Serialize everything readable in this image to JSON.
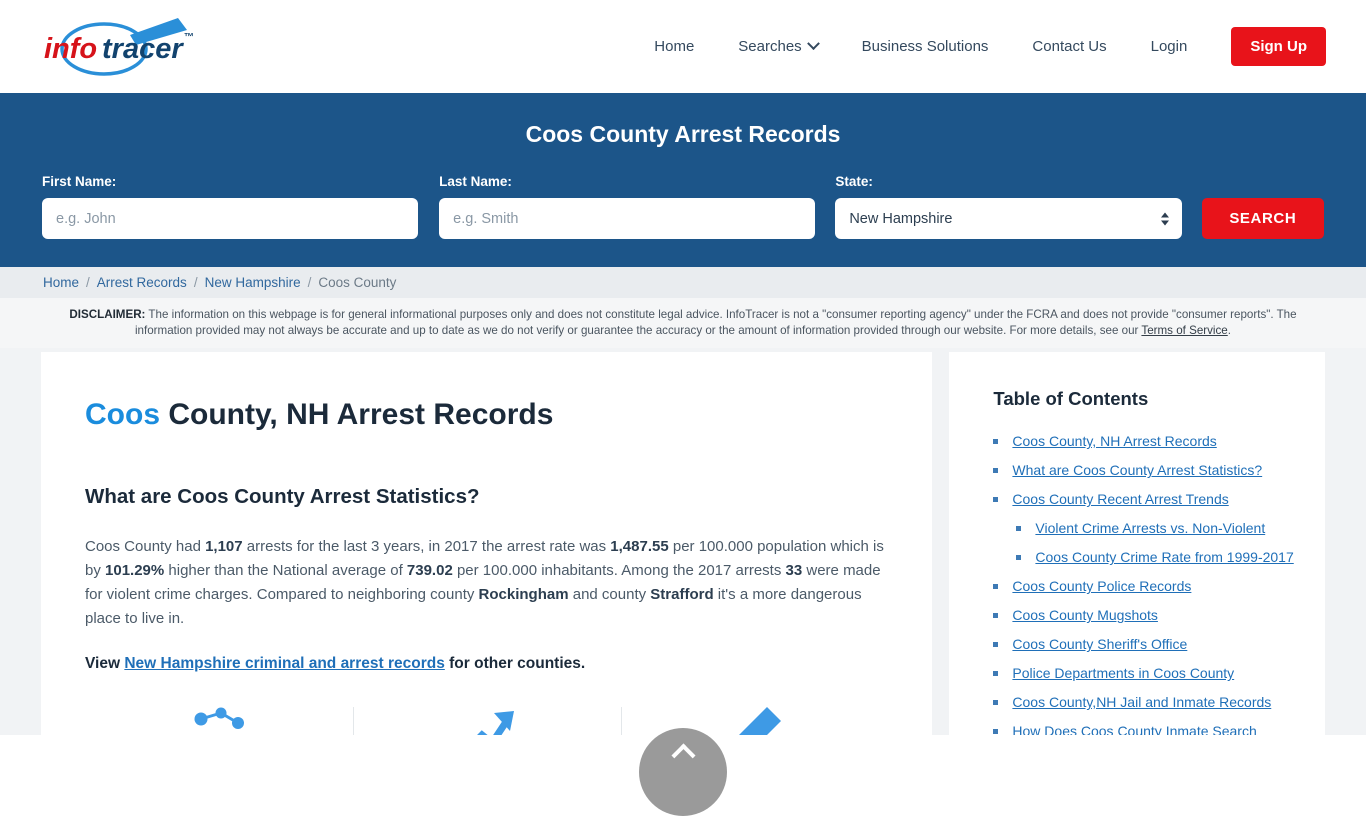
{
  "brand": {
    "name_part1": "info",
    "name_part2": "tracer",
    "trademark": "™",
    "color_red": "#d6131a",
    "color_blue": "#1b6fb5",
    "color_navy": "#12436e"
  },
  "nav": {
    "items": [
      {
        "label": "Home",
        "has_caret": false
      },
      {
        "label": "Searches",
        "has_caret": true
      },
      {
        "label": "Business Solutions",
        "has_caret": false
      },
      {
        "label": "Contact Us",
        "has_caret": false
      },
      {
        "label": "Login",
        "has_caret": false
      }
    ],
    "signup_label": "Sign Up",
    "signup_color": "#e8131a"
  },
  "banner": {
    "title": "Coos County Arrest Records",
    "background": "#1c5589",
    "first_name_label": "First Name:",
    "first_name_placeholder": "e.g. John",
    "first_name_value": "",
    "last_name_label": "Last Name:",
    "last_name_placeholder": "e.g. Smith",
    "last_name_value": "",
    "state_label": "State:",
    "state_selected": "New Hampshire",
    "search_label": "SEARCH"
  },
  "breadcrumb": {
    "items": [
      "Home",
      "Arrest Records",
      "New Hampshire",
      "Coos County"
    ],
    "separator": "/"
  },
  "disclaimer": {
    "prefix": "DISCLAIMER:",
    "text": " The information on this webpage is for general informational purposes only and does not constitute legal advice. InfoTracer is not a \"consumer reporting agency\" under the FCRA and does not provide \"consumer reports\". The information provided may not always be accurate and up to date as we do not verify or guarantee the accuracy or the amount of information provided through our website. For more details, see our ",
    "link_label": "Terms of Service",
    "suffix": "."
  },
  "main": {
    "title_highlight": "Coos",
    "title_rest": " County, NH Arrest Records",
    "subtitle": "What are Coos County Arrest Statistics?",
    "paragraph": {
      "s1": "Coos County had ",
      "arrests": "1,107",
      "s2": " arrests for the last 3 years, in 2017 the arrest rate was ",
      "rate": "1,487.55",
      "s3": " per 100.000 population which is by ",
      "percent": "101.29%",
      "s4": " higher than the National average of ",
      "national": "739.02",
      "s5": " per 100.000 inhabitants. Among the 2017 arrests ",
      "violent": "33",
      "s6": " were made for violent crime charges. Compared to neighboring county ",
      "county1": "Rockingham",
      "s7": " and county ",
      "county2": "Strafford",
      "s8": " it's a more dangerous place to live in."
    },
    "view_prefix": "View ",
    "view_link": "New Hampshire criminal and arrest records",
    "view_suffix": " for other counties.",
    "icons": [
      "people-network-icon",
      "trending-up-arrow-icon",
      "pencil-icon"
    ],
    "icon_color": "#3e9ae5"
  },
  "toc": {
    "heading": "Table of Contents",
    "items": [
      {
        "label": "Coos County, NH Arrest Records",
        "sub": false
      },
      {
        "label": "What are Coos County Arrest Statistics?",
        "sub": false
      },
      {
        "label": "Coos County Recent Arrest Trends",
        "sub": false
      },
      {
        "label": "Violent Crime Arrests vs. Non-Violent",
        "sub": true
      },
      {
        "label": "Coos County Crime Rate from 1999-2017",
        "sub": true
      },
      {
        "label": "Coos County Police Records",
        "sub": false
      },
      {
        "label": "Coos County Mugshots",
        "sub": false
      },
      {
        "label": "Coos County Sheriff's Office",
        "sub": false
      },
      {
        "label": "Police Departments in Coos County",
        "sub": false
      },
      {
        "label": "Coos County,NH Jail and Inmate Records",
        "sub": false
      },
      {
        "label": "How Does Coos County Inmate Search Work?",
        "sub": false
      }
    ]
  },
  "scroll_top": {
    "icon": "chevron-up-icon",
    "color": "#9a9a9a"
  }
}
